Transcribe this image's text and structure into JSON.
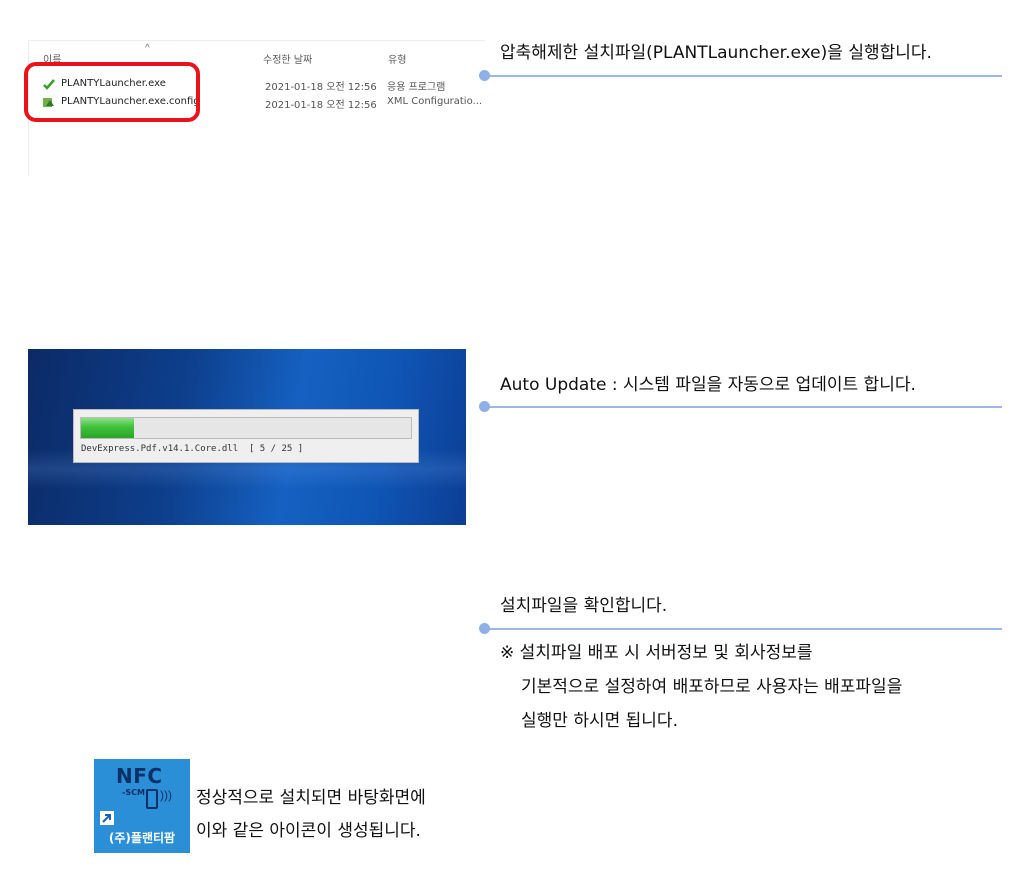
{
  "step1": {
    "explorer": {
      "columns": {
        "name": "이름",
        "modified": "수정한 날짜",
        "type": "유형"
      },
      "sort_indicator": "^",
      "files": [
        {
          "name": "PLANTYLauncher.exe",
          "modified": "2021-01-18 오전 12:56",
          "type": "응용 프로그램",
          "icon": "app-check-icon"
        },
        {
          "name": "PLANTYLauncher.exe.config",
          "modified": "2021-01-18 오전 12:56",
          "type": "XML Configuratio...",
          "icon": "config-file-icon"
        }
      ]
    },
    "caption": "압축해제한 설치파일(PLANTLauncher.exe)을 실행합니다."
  },
  "step2": {
    "progress": {
      "text": "DevExpress.Pdf.v14.1.Core.dll  [ 5 / 25 ]",
      "current": 5,
      "total": 25,
      "fill_fraction": 0.16
    },
    "caption": "Auto Update : 시스템 파일을 자동으로 업데이트 합니다."
  },
  "step3": {
    "caption": "설치파일을 확인합니다.",
    "note_lines": [
      "※ 설치파일 배포 시 서버정보 및 회사정보를",
      "기본적으로 설정하여 배포하므로 사용자는 배포파일을",
      "실행만 하시면 됩니다."
    ]
  },
  "step4": {
    "icon": {
      "title": "NFC",
      "subtitle": "-SCM",
      "label": "(주)플랜티팜"
    },
    "desc_lines": [
      "정상적으로 설치되면 바탕화면에",
      "이와 같은 아이콘이 생성됩니다."
    ]
  },
  "colors": {
    "highlight": "#e8141a",
    "timeline": "#9ab8e8",
    "progress": "#3fc13a",
    "icon_bg": "#2a8fd6"
  }
}
